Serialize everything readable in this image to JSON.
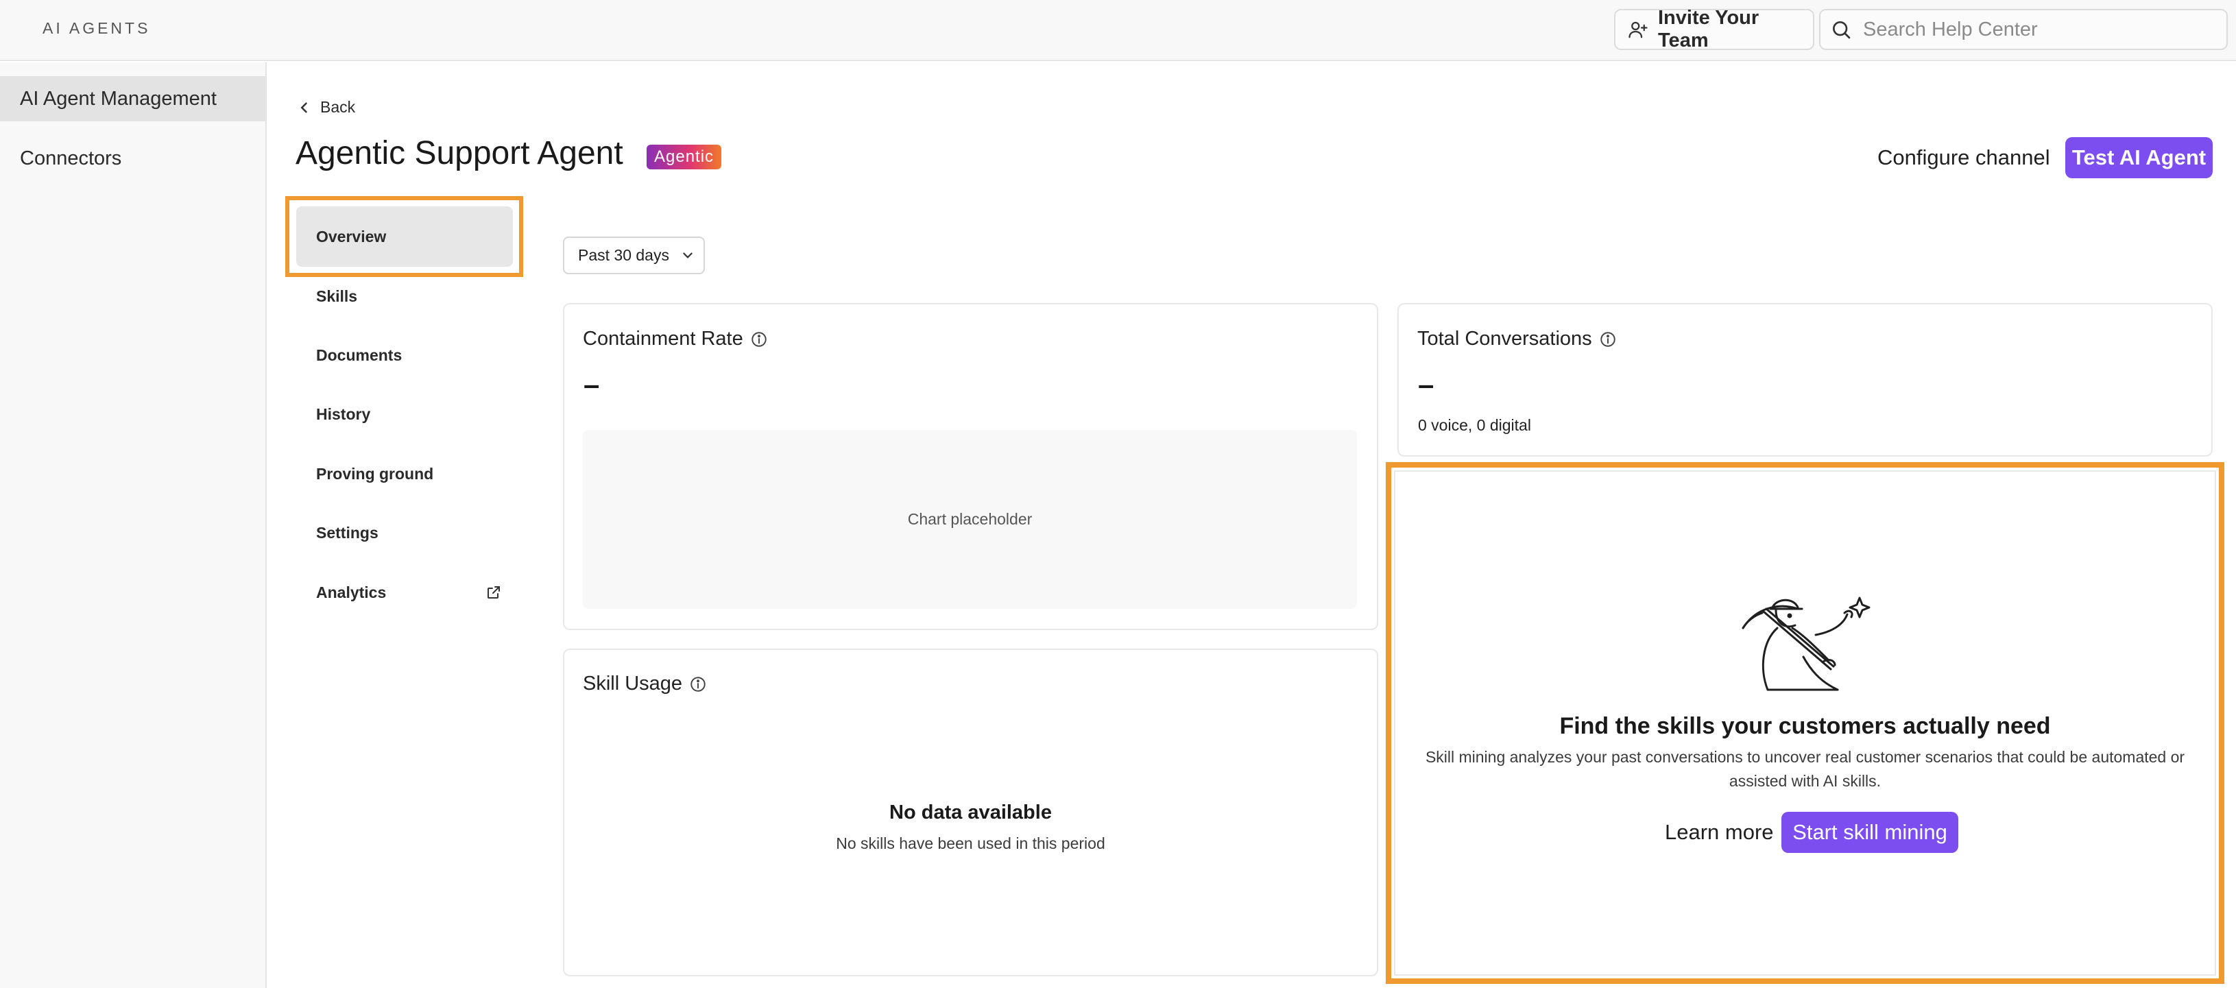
{
  "app": {
    "brand": "AI AGENTS"
  },
  "topbar": {
    "invite_label": "Invite Your Team",
    "search_placeholder": "Search Help Center"
  },
  "sidebar": {
    "items": [
      {
        "label": "AI Agent Management",
        "active": true
      },
      {
        "label": "Connectors",
        "active": false
      }
    ]
  },
  "header": {
    "back_label": "Back",
    "title": "Agentic Support Agent",
    "badge": "Agentic",
    "configure_label": "Configure channel",
    "test_label": "Test AI Agent"
  },
  "subnav": {
    "items": [
      {
        "label": "Overview",
        "active": true
      },
      {
        "label": "Skills"
      },
      {
        "label": "Documents"
      },
      {
        "label": "History"
      },
      {
        "label": "Proving ground"
      },
      {
        "label": "Settings"
      },
      {
        "label": "Analytics",
        "icon": "external-link-icon"
      }
    ]
  },
  "filter": {
    "period": "Past 30 days"
  },
  "cards": {
    "containment": {
      "title": "Containment Rate",
      "value": "–",
      "placeholder": "Chart placeholder"
    },
    "total": {
      "title": "Total Conversations",
      "value": "–",
      "breakdown": "0 voice, 0 digital"
    },
    "skill_usage": {
      "title": "Skill Usage",
      "empty_title": "No data available",
      "empty_desc": "No skills have been used in this period"
    },
    "skill_mining": {
      "illustration": "miner-with-pickaxe-illustration",
      "title": "Find the skills your customers actually need",
      "description": "Skill mining analyzes your past conversations to uncover real customer scenarios that could be automated or assisted with AI skills.",
      "learn_label": "Learn more",
      "start_label": "Start skill mining"
    }
  },
  "colors": {
    "accent": "#7c4ef0",
    "highlight": "#f0992e"
  }
}
